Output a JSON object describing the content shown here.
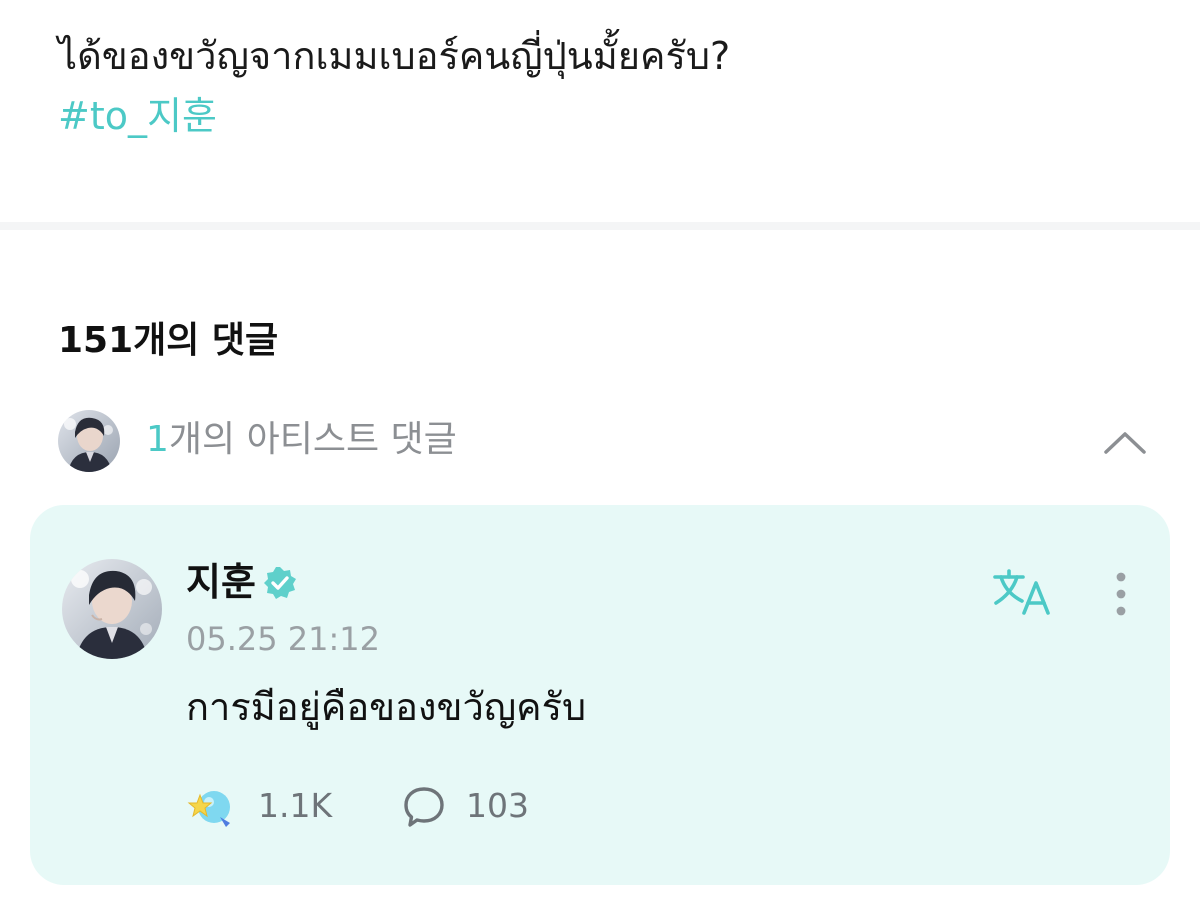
{
  "post": {
    "text": "ได้ของขวัญจากเมมเบอร์คนญี่ปุ่นมั้ยครับ?",
    "hashtag": "#to_지훈"
  },
  "comments": {
    "count_label": "151개의 댓글"
  },
  "artist_comments": {
    "count": "1",
    "label": "개의 아티스트 댓글",
    "expanded": true
  },
  "artist_comment": {
    "author": "지훈",
    "verified": true,
    "timestamp": "05.25 21:12",
    "body": "การมีอยู่คือของขวัญครับ",
    "likes": "1.1K",
    "replies": "103"
  },
  "colors": {
    "accent": "#4cc9c6",
    "card_background": "#e7f9f7",
    "muted_text": "#8c8f93"
  },
  "icons": {
    "collapse": "chevron-up-icon",
    "verified": "verified-badge-icon",
    "translate": "translate-icon",
    "more": "more-vertical-icon",
    "like": "star-wand-icon",
    "reply": "speech-bubble-icon"
  }
}
